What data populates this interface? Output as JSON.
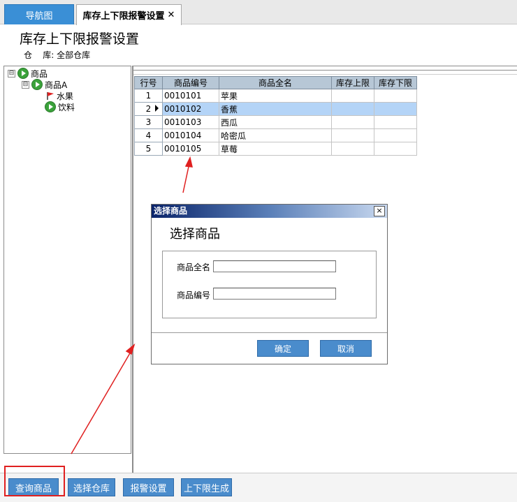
{
  "tabs": {
    "nav_label": "导航图",
    "active_label": "库存上下限报警设置",
    "close_glyph": "✕"
  },
  "page": {
    "title": "库存上下限报警设置",
    "warehouse_text": "仓    库: 全部仓库"
  },
  "tree": {
    "root": {
      "label": "商品",
      "expander": "⊟"
    },
    "child": {
      "label": "商品A",
      "expander": "⊟"
    },
    "leaves": [
      {
        "label": "水果",
        "icon": "flag-icon"
      },
      {
        "label": "饮料",
        "icon": "play-icon"
      }
    ]
  },
  "grid": {
    "columns": [
      "行号",
      "商品编号",
      "商品全名",
      "库存上限",
      "库存下限"
    ],
    "rows": [
      {
        "no": "1",
        "code": "0010101",
        "name": "苹果",
        "upper": "",
        "lower": ""
      },
      {
        "no": "2",
        "code": "0010102",
        "name": "香蕉",
        "upper": "",
        "lower": ""
      },
      {
        "no": "3",
        "code": "0010103",
        "name": "西瓜",
        "upper": "",
        "lower": ""
      },
      {
        "no": "4",
        "code": "0010104",
        "name": "哈密瓜",
        "upper": "",
        "lower": ""
      },
      {
        "no": "5",
        "code": "0010105",
        "name": "草莓",
        "upper": "",
        "lower": ""
      }
    ],
    "selected_row": 2
  },
  "dialog": {
    "title": "选择商品",
    "close_glyph": "×",
    "heading": "选择商品",
    "full_name_label": "商品全名",
    "full_name_value": "",
    "code_label": "商品编号",
    "code_value": "",
    "ok_label": "确定",
    "cancel_label": "取消"
  },
  "toolbar": {
    "query_label": "查询商品",
    "warehouse_label": "选择仓库",
    "alarm_label": "报警设置",
    "generate_label": "上下限生成"
  },
  "colors": {
    "button_blue": "#4a8ccc",
    "selection_blue": "#b4d4f7",
    "annotation_red": "#e02020",
    "grid_header": "#b7c7d6"
  }
}
